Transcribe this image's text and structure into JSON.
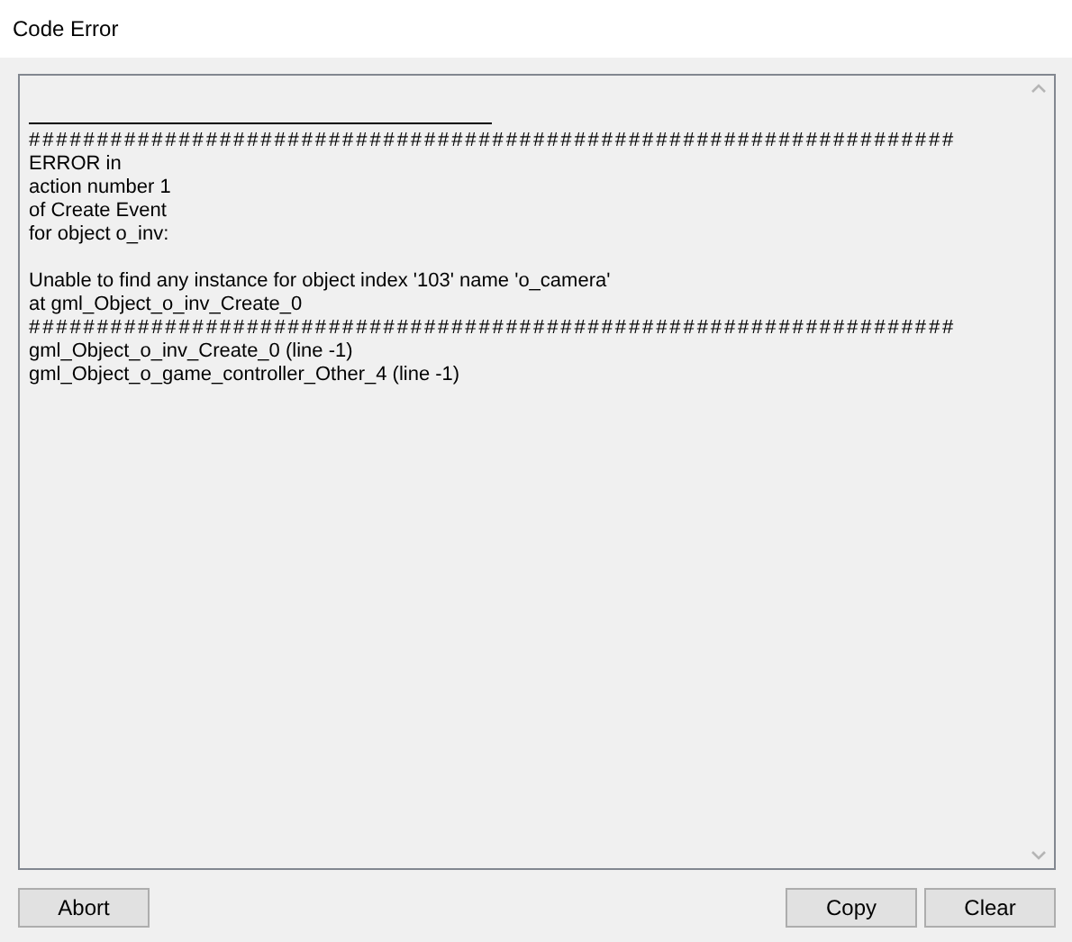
{
  "window": {
    "title": "Code Error"
  },
  "log": {
    "lines": [
      {
        "kind": "rule"
      },
      {
        "kind": "hash",
        "text": "####################################################################"
      },
      {
        "kind": "text",
        "text": "ERROR in"
      },
      {
        "kind": "text",
        "text": "action number 1"
      },
      {
        "kind": "text",
        "text": "of Create Event"
      },
      {
        "kind": "text",
        "text": "for object o_inv:"
      },
      {
        "kind": "blank"
      },
      {
        "kind": "text",
        "text": "Unable to find any instance for object index '103' name 'o_camera'"
      },
      {
        "kind": "text",
        "text": "at gml_Object_o_inv_Create_0"
      },
      {
        "kind": "hash",
        "text": "####################################################################"
      },
      {
        "kind": "text",
        "text": "gml_Object_o_inv_Create_0 (line -1)"
      },
      {
        "kind": "text",
        "text": "gml_Object_o_game_controller_Other_4 (line -1)"
      }
    ]
  },
  "buttons_left": [
    "Abort"
  ],
  "buttons_right": [
    "Copy",
    "Clear"
  ]
}
